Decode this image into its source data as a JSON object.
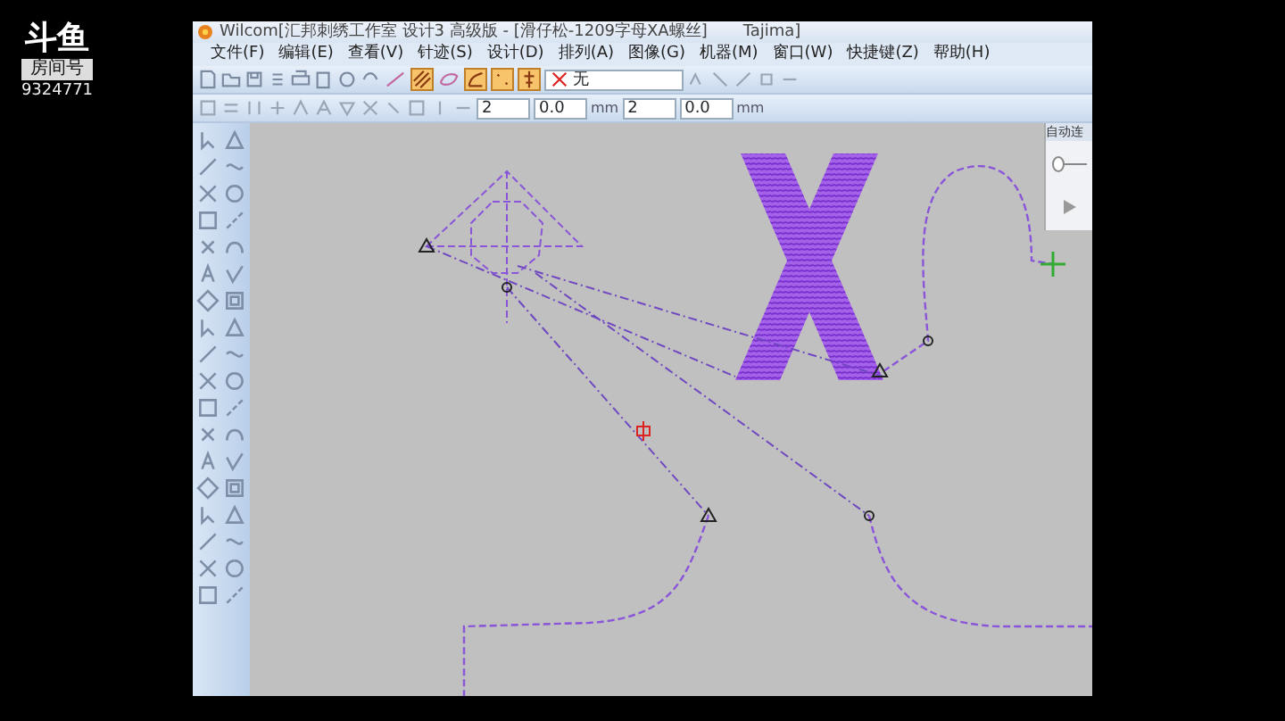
{
  "stream_overlay": {
    "logo": "斗鱼",
    "room_label": "房间号",
    "room_number": "9324771"
  },
  "window": {
    "title": "Wilcom[汇邦刺绣工作室 设计3 高级版 - [滑仔松-1209字母XA螺丝]",
    "title_right": "Tajima]"
  },
  "menu": [
    "文件(F)",
    "编辑(E)",
    "查看(V)",
    "针迹(S)",
    "设计(D)",
    "排列(A)",
    "图像(G)",
    "机器(M)",
    "窗口(W)",
    "快捷键(Z)",
    "帮助(H)"
  ],
  "stitch_buttons": [
    {
      "selected": false
    },
    {
      "selected": true
    },
    {
      "selected": false
    },
    {
      "selected": true
    },
    {
      "selected": true
    },
    {
      "selected": true
    }
  ],
  "color_combo": {
    "value": "无"
  },
  "spinners": [
    {
      "value": "2"
    },
    {
      "value": "0.0",
      "unit": "mm"
    },
    {
      "value": "2"
    },
    {
      "value": "0.0",
      "unit": "mm"
    }
  ],
  "side_panel": {
    "title": "自动连"
  }
}
